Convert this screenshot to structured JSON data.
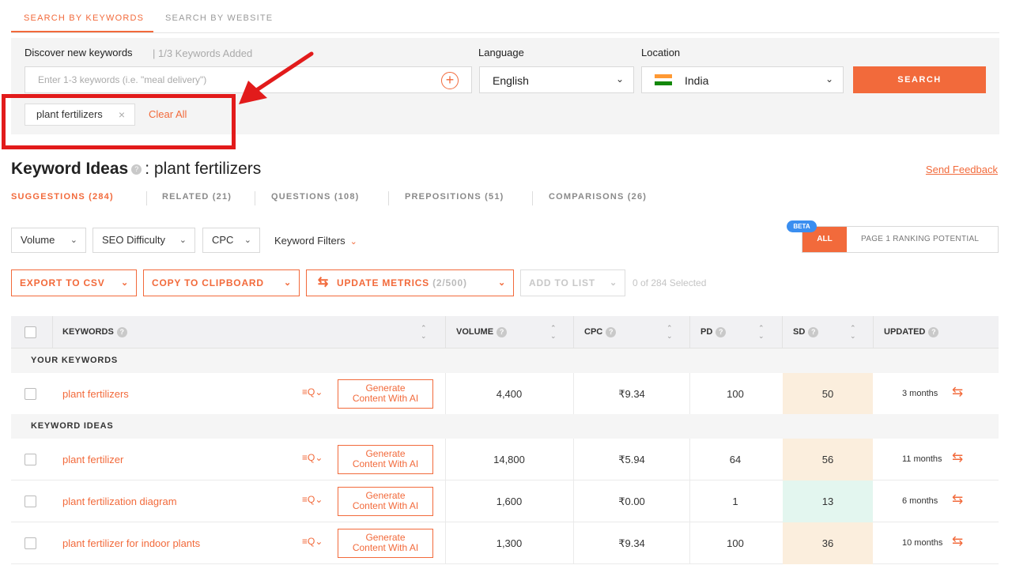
{
  "top_tabs": [
    "SEARCH BY KEYWORDS",
    "SEARCH BY WEBSITE"
  ],
  "search": {
    "discover_label": "Discover new keywords",
    "added_text": "| 1/3 Keywords Added",
    "placeholder": "Enter 1-3 keywords (i.e. \"meal delivery\")",
    "language_label": "Language",
    "language_value": "English",
    "location_label": "Location",
    "location_value": "India",
    "search_button": "SEARCH",
    "chip": "plant fertilizers",
    "clear_all": "Clear All"
  },
  "ideas": {
    "title": "Keyword Ideas",
    "query": ": plant fertilizers",
    "send_feedback": "Send Feedback",
    "tabs": [
      "SUGGESTIONS (284)",
      "RELATED (21)",
      "QUESTIONS (108)",
      "PREPOSITIONS (51)",
      "COMPARISONS (26)"
    ]
  },
  "filters": {
    "volume": "Volume",
    "seo_difficulty": "SEO Difficulty",
    "cpc": "CPC",
    "keyword_filters": "Keyword Filters",
    "beta": "BETA",
    "all": "ALL",
    "page1": "PAGE 1 RANKING POTENTIAL"
  },
  "actions": {
    "export": "EXPORT TO CSV",
    "copy": "COPY TO CLIPBOARD",
    "update": "UPDATE METRICS",
    "update_count": "(2/500)",
    "add_to_list": "ADD TO LIST",
    "selected": "0 of 284 Selected"
  },
  "table": {
    "headers": [
      "KEYWORDS",
      "VOLUME",
      "CPC",
      "PD",
      "SD",
      "UPDATED"
    ],
    "section_your": "YOUR KEYWORDS",
    "section_ideas": "KEYWORD IDEAS",
    "generate_line1": "Generate",
    "generate_line2": "Content With AI",
    "your_rows": [
      {
        "keyword": "plant fertilizers",
        "volume": "4,400",
        "cpc": "₹9.34",
        "pd": "100",
        "sd": "50",
        "updated": "3 months"
      }
    ],
    "idea_rows": [
      {
        "keyword": "plant fertilizer",
        "volume": "14,800",
        "cpc": "₹5.94",
        "pd": "64",
        "sd": "56",
        "updated": "11 months"
      },
      {
        "keyword": "plant fertilization diagram",
        "volume": "1,600",
        "cpc": "₹0.00",
        "pd": "1",
        "sd": "13",
        "updated": "6 months"
      },
      {
        "keyword": "plant fertilizer for indoor plants",
        "volume": "1,300",
        "cpc": "₹9.34",
        "pd": "100",
        "sd": "36",
        "updated": "10 months"
      }
    ]
  },
  "colors": {
    "accent": "#f26a3b",
    "annotation_red": "#e21b1b",
    "sd_medium": "#fbeedd",
    "sd_easy": "#e3f6ef"
  }
}
